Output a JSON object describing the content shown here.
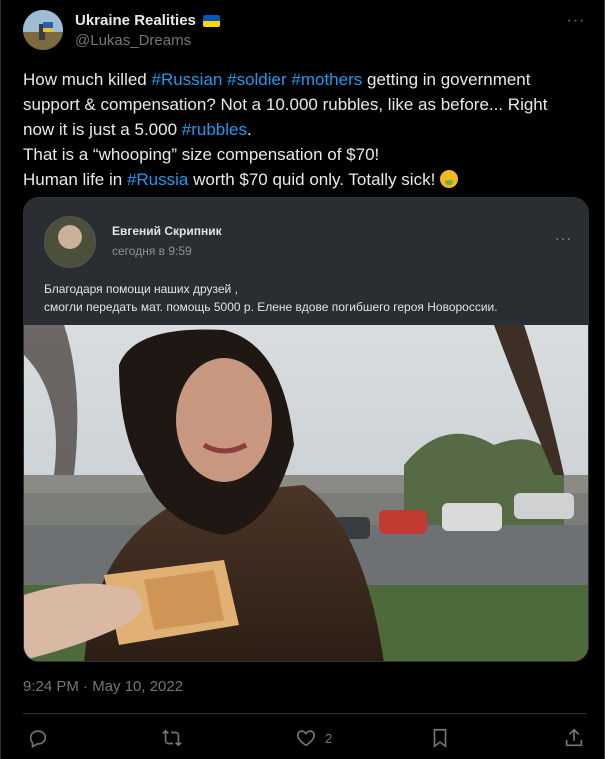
{
  "author": {
    "name": "Ukraine Realities",
    "handle": "@Lukas_Dreams",
    "flag_colors": [
      "#0057b7",
      "#ffd700"
    ]
  },
  "more_icon": "more-horizontal-icon",
  "tweet": {
    "lines": [
      [
        {
          "t": "How much killed "
        },
        {
          "t": "#Russian",
          "tag": true
        },
        {
          "t": " "
        },
        {
          "t": "#soldier",
          "tag": true
        },
        {
          "t": " "
        },
        {
          "t": "#mothers",
          "tag": true
        },
        {
          "t": " getting in government"
        }
      ],
      [
        {
          "t": "support & compensation? Not a 10.000 rubbles, like as before... Right"
        }
      ],
      [
        {
          "t": "now it is just a 5.000 "
        },
        {
          "t": "#rubbles",
          "tag": true
        },
        {
          "t": "."
        }
      ],
      [
        {
          "t": "That is a “whooping” size compensation of $70!"
        }
      ],
      [
        {
          "t": "Human life in "
        },
        {
          "t": "#Russia",
          "tag": true
        },
        {
          "t": " worth $70 quid only. Totally sick! "
        },
        {
          "t": "",
          "emoji": "nauseated-face-emoji"
        }
      ]
    ],
    "link_color": "#1d9bf0"
  },
  "embedded_post": {
    "author_name": "Евгений Скрипник",
    "time": "сегодня в 9:59",
    "text_line1": "Благодаря помощи наших друзей ,",
    "text_line2": "смогли передать мат. помощь 5000 р. Елене вдове погибшего героя Новороссии."
  },
  "timestamp": "9:24 PM · May 10, 2022",
  "actions": {
    "reply_icon": "reply-icon",
    "retweet_icon": "retweet-icon",
    "like_icon": "heart-icon",
    "like_count": "2",
    "bookmark_icon": "bookmark-icon",
    "share_icon": "share-icon"
  }
}
